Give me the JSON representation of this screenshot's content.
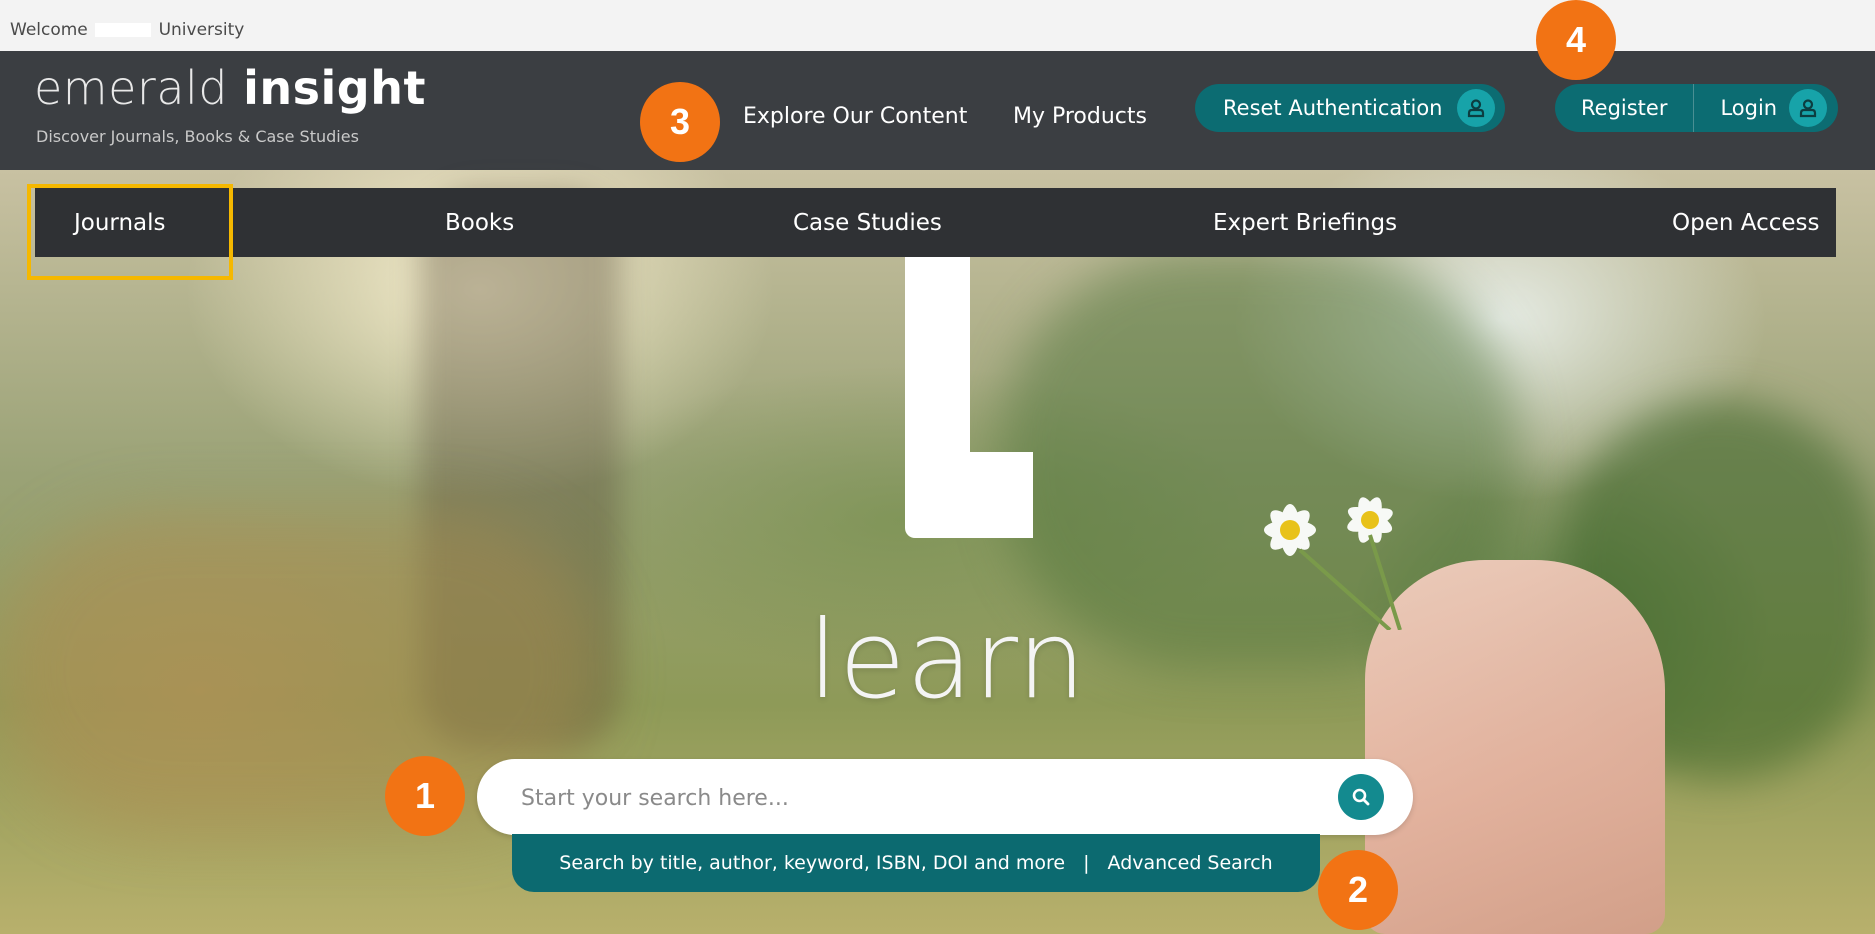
{
  "welcome": {
    "prefix": "Welcome",
    "suffix": "University"
  },
  "logo": {
    "word_light": "emerald",
    "word_bold": "insight",
    "tagline": "Discover Journals, Books & Case Studies"
  },
  "header_nav": {
    "explore": "Explore Our Content",
    "my_products": "My Products",
    "reset_auth": "Reset Authentication",
    "register": "Register",
    "login": "Login",
    "icon": "user-icon"
  },
  "categories": [
    "Journals",
    "Books",
    "Case Studies",
    "Expert Briefings",
    "Open Access"
  ],
  "hero": {
    "word": "learn"
  },
  "search": {
    "placeholder": "Start your search here...",
    "icon": "search-icon",
    "help_text": "Search by title, author, keyword, ISBN, DOI and more",
    "separator": "|",
    "advanced_label": "Advanced Search"
  },
  "annotations": {
    "search_box": "1",
    "search_button": "2",
    "explore": "3",
    "register_login": "4"
  },
  "colors": {
    "header": "#3b3e42",
    "category_bar": "#2f3134",
    "teal": "#0c6c72",
    "teal_light": "#17a3a9",
    "highlight": "#f5b800",
    "badge": "#f27314"
  }
}
